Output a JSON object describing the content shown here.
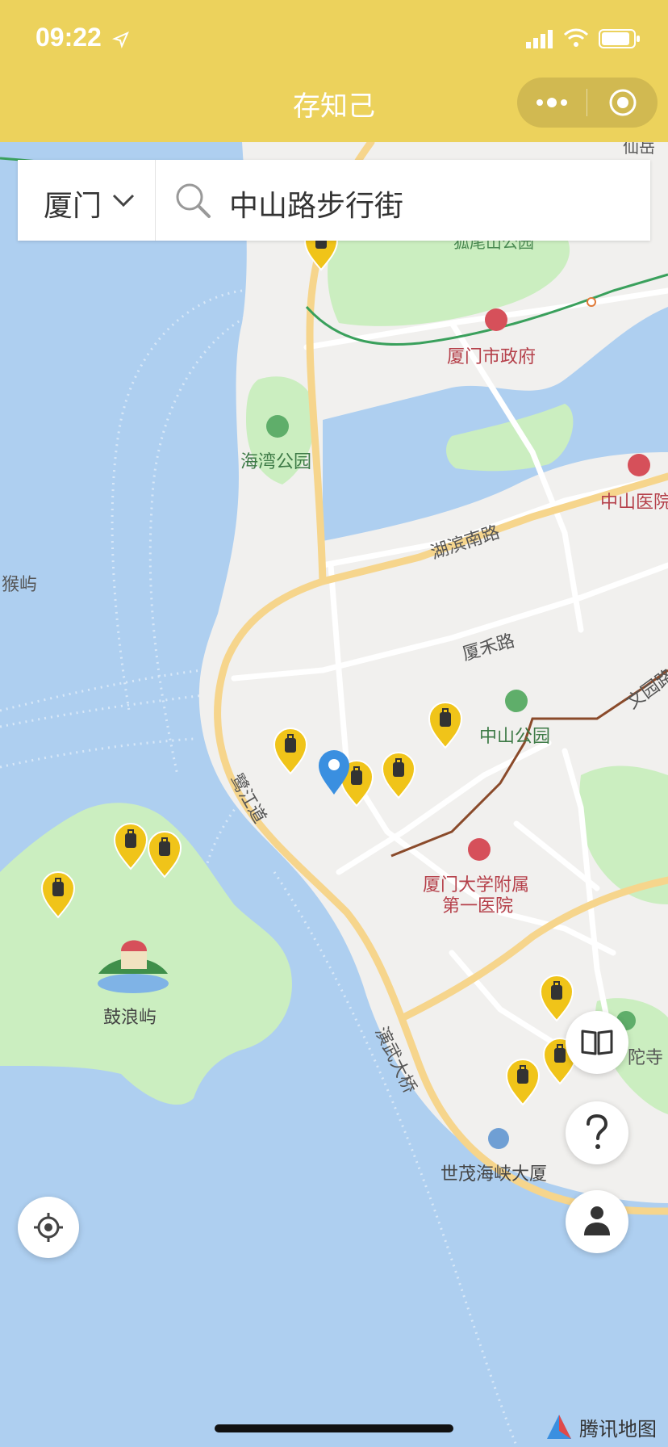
{
  "status_bar": {
    "time": "09:22"
  },
  "app": {
    "title": "存知己"
  },
  "search": {
    "city": "厦门",
    "query": "中山路步行街"
  },
  "map": {
    "labels": {
      "government": "厦门市政府",
      "bay_park": "海湾公园",
      "zhongshan_hospital": "中山医院",
      "hubin_south_road": "湖滨南路",
      "houyu": "猴屿",
      "xiahe_road": "厦禾路",
      "zhongshan_park": "中山公园",
      "wenyuan_road": "文园路",
      "lujiang_road": "鹭江道",
      "xmu_hospital_line1": "厦门大学附属",
      "xmu_hospital_line2": "第一医院",
      "gulangyu": "鼓浪屿",
      "yanwu_bridge": "演武大桥",
      "temple": "陀寺",
      "shimao": "世茂海峡大厦",
      "park_top_partial": "狐尾山公园",
      "top_right_partial": "仙岳"
    },
    "brand": "腾讯地图"
  },
  "colors": {
    "header": "#ecd25c",
    "water": "#aecff0",
    "land": "#f1f0ee",
    "green": "#cbeec0",
    "road": "#f6d58c",
    "pin": "#f0c419",
    "location_pin": "#3a8fe0"
  },
  "icons": {
    "location": "navigation-arrow-icon",
    "signal": "signal-icon",
    "wifi": "wifi-icon",
    "battery": "battery-icon",
    "more": "more-dots-icon",
    "close": "close-circle-icon",
    "dropdown": "chevron-down-icon",
    "search": "search-icon",
    "guide": "book-icon",
    "help": "question-icon",
    "profile": "person-icon",
    "locate": "locate-icon",
    "luggage": "luggage-icon"
  }
}
